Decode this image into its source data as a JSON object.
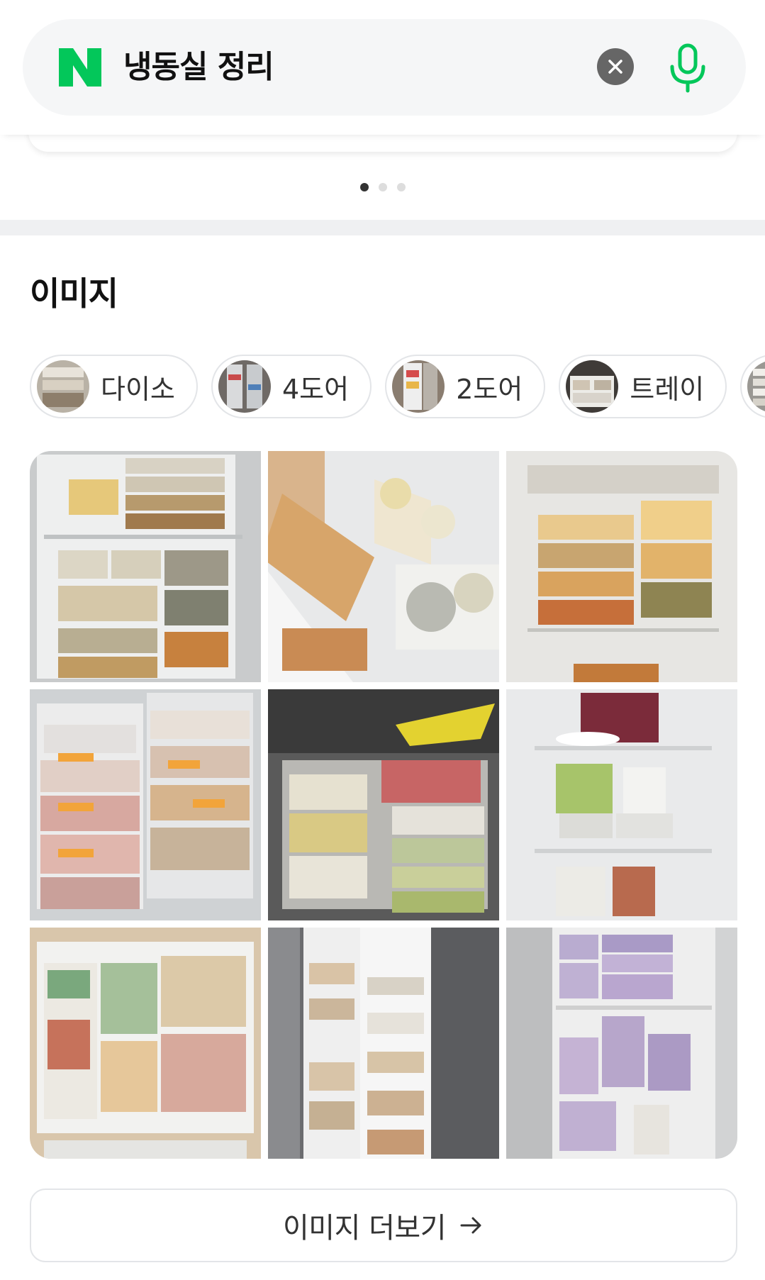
{
  "search": {
    "query": "냉동실 정리",
    "brand_color": "#03c75a"
  },
  "carousel": {
    "pages": 3,
    "active_page": 1
  },
  "images_section": {
    "title": "이미지",
    "chips": [
      {
        "label": "다이소",
        "icon": "thumbnail"
      },
      {
        "label": "4도어",
        "icon": "thumbnail"
      },
      {
        "label": "2도어",
        "icon": "thumbnail"
      },
      {
        "label": "트레이",
        "icon": "thumbnail"
      },
      {
        "label": "",
        "icon": "thumbnail"
      }
    ],
    "more_label": "이미지 더보기",
    "more_icon": "arrow-right-icon"
  }
}
